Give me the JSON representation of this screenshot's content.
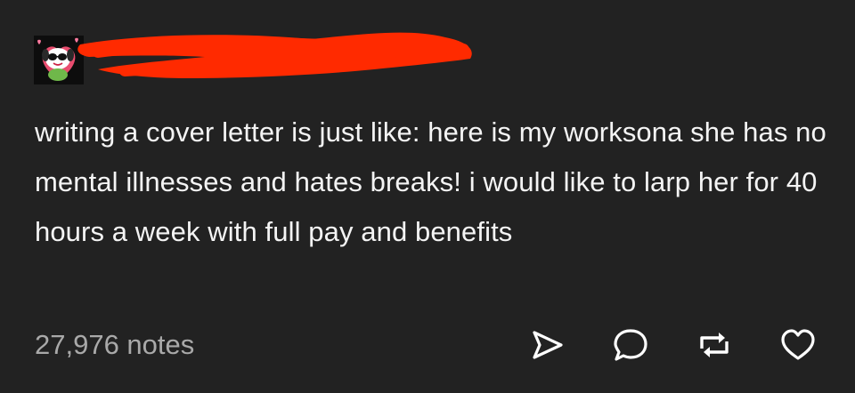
{
  "post": {
    "body_text": "writing a cover letter is just like: here is my worksona she has no mental illnesses and hates breaks! i would like to larp her for 40 hours a week with full pay and benefits",
    "notes_count": "27,976 notes"
  },
  "colors": {
    "background": "#222222",
    "text": "#f4f4f4",
    "muted": "#a9a9a9",
    "redaction": "#ff2a00",
    "icon": "#ffffff"
  },
  "icons": {
    "share": "share-icon",
    "reply": "reply-icon",
    "reblog": "reblog-icon",
    "like": "heart-icon",
    "avatar": "avatar-image"
  }
}
